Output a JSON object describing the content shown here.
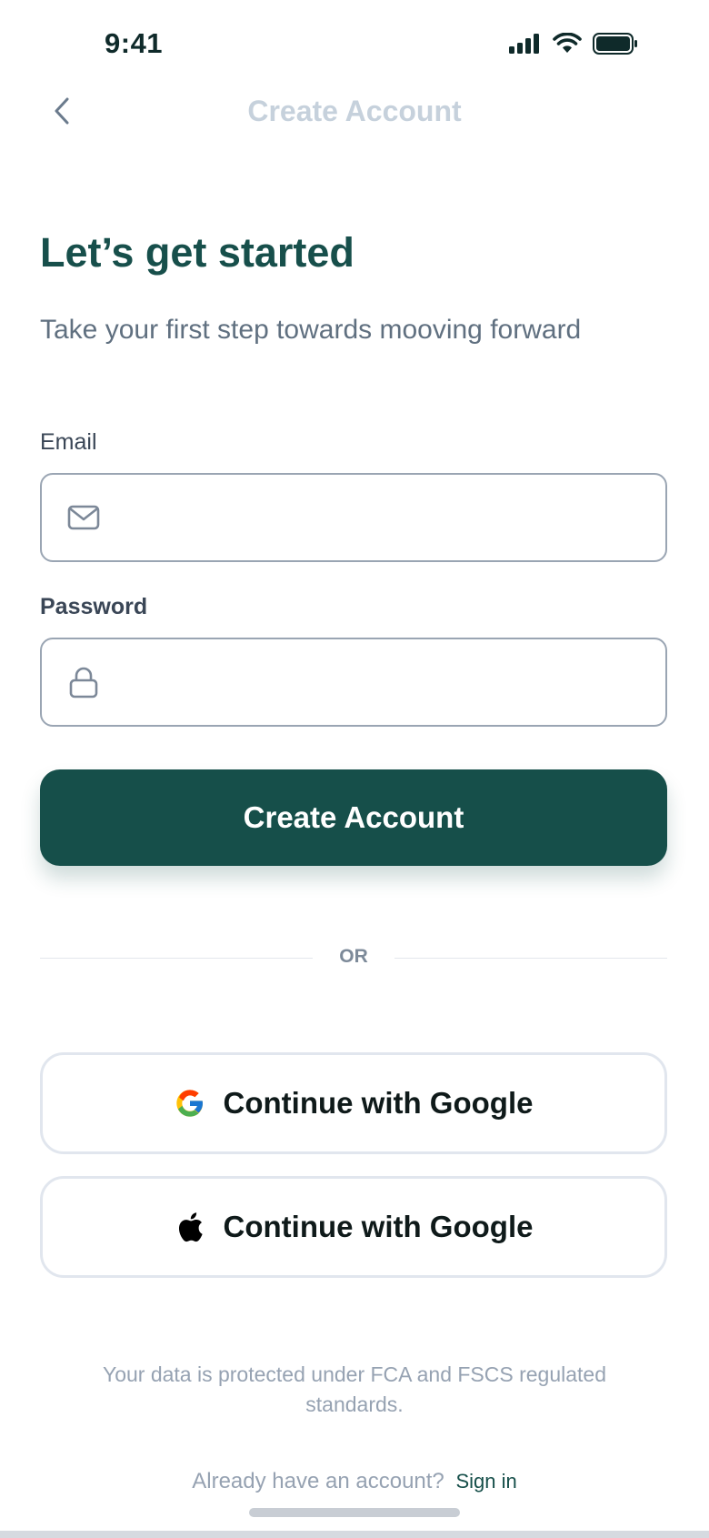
{
  "status_bar": {
    "time": "9:41"
  },
  "nav": {
    "title": "Create Account"
  },
  "header": {
    "title": "Let’s get started",
    "subtitle": "Take your first step towards mooving forward"
  },
  "form": {
    "email": {
      "label": "Email",
      "value": "",
      "placeholder": ""
    },
    "password": {
      "label": "Password",
      "value": "",
      "placeholder": ""
    },
    "submit_label": "Create Account"
  },
  "divider": {
    "label": "OR"
  },
  "social": [
    {
      "label": "Continue with Google",
      "icon": "google-icon"
    },
    {
      "label": "Continue with Google",
      "icon": "apple-icon"
    }
  ],
  "footer": {
    "disclaimer": "Your data is protected under FCA and FSCS regulated standards.",
    "signin_prompt": "Already have an account?",
    "signin_link": "Sign in"
  },
  "colors": {
    "primary": "#164f4a",
    "heading": "#174f4b",
    "muted": "#96a2b2",
    "field_border": "#9aa5b3"
  }
}
